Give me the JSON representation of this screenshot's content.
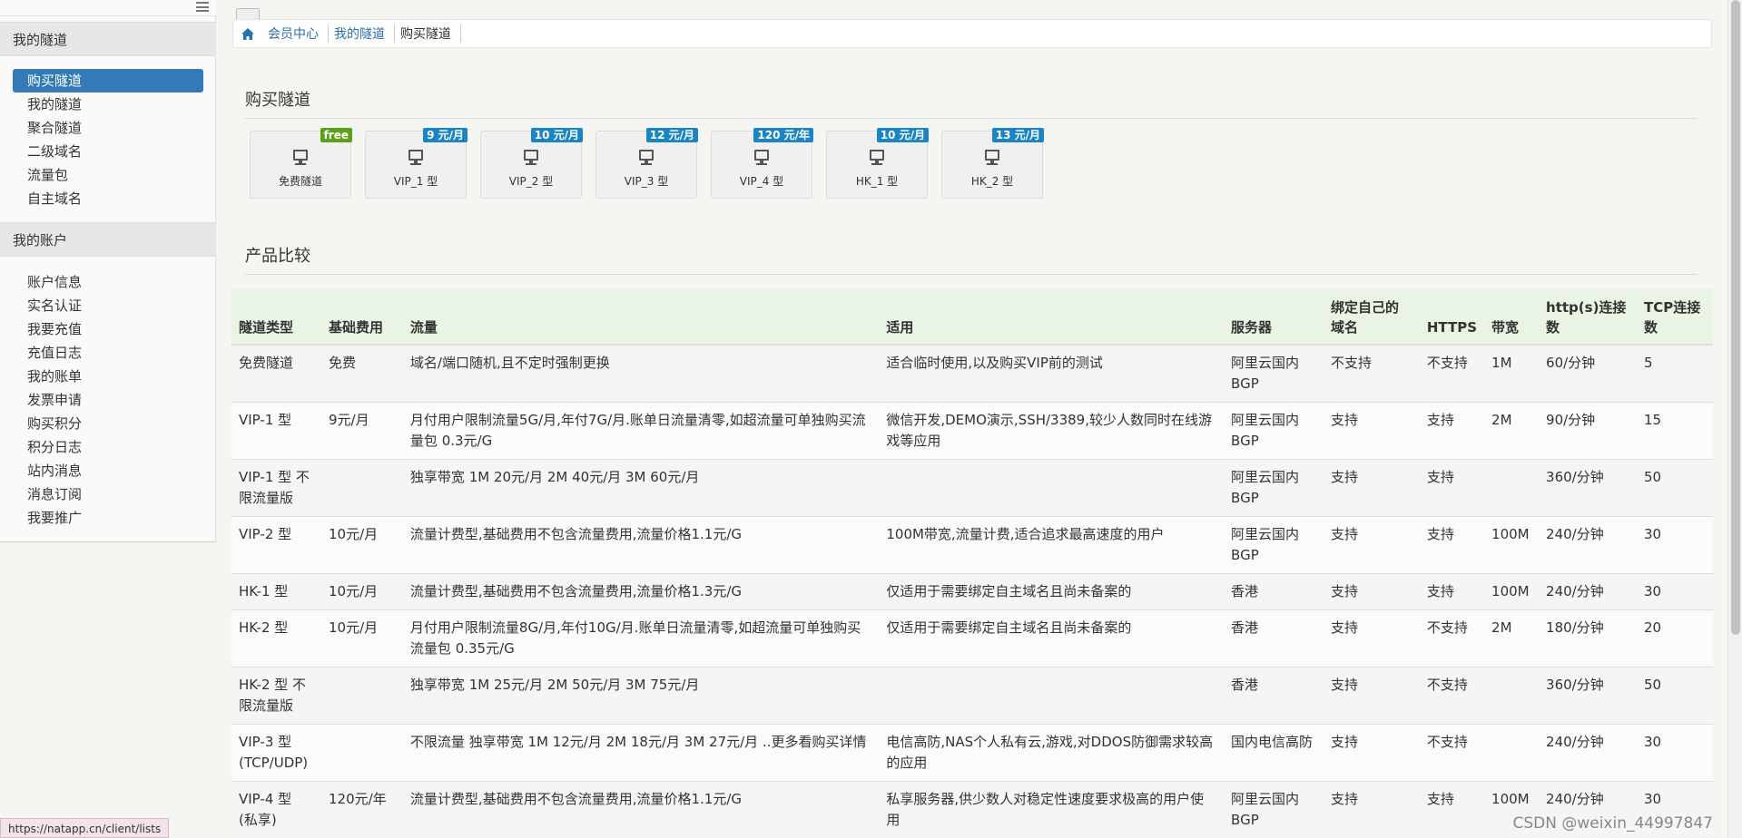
{
  "sidebar": {
    "sections": [
      {
        "title": "我的隧道",
        "items": [
          {
            "label": "购买隧道",
            "active": true
          },
          {
            "label": "我的隧道",
            "active": false
          },
          {
            "label": "聚合隧道",
            "active": false
          },
          {
            "label": "二级域名",
            "active": false
          },
          {
            "label": "流量包",
            "active": false
          },
          {
            "label": "自主域名",
            "active": false
          }
        ]
      },
      {
        "title": "我的账户",
        "items": [
          {
            "label": "账户信息"
          },
          {
            "label": "实名认证"
          },
          {
            "label": "我要充值"
          },
          {
            "label": "充值日志"
          },
          {
            "label": "我的账单"
          },
          {
            "label": "发票申请"
          },
          {
            "label": "购买积分"
          },
          {
            "label": "积分日志"
          },
          {
            "label": "站内消息"
          },
          {
            "label": "消息订阅"
          },
          {
            "label": "我要推广"
          }
        ]
      }
    ]
  },
  "breadcrumb": {
    "items": [
      "会员中心",
      "我的隧道",
      "购买隧道"
    ]
  },
  "buy_section_title": "购买隧道",
  "tunnel_cards": [
    {
      "label": "免费隧道",
      "badge": "free"
    },
    {
      "label": "VIP_1 型",
      "badge": "9 元/月"
    },
    {
      "label": "VIP_2 型",
      "badge": "10 元/月"
    },
    {
      "label": "VIP_3 型",
      "badge": "12 元/月"
    },
    {
      "label": "VIP_4 型",
      "badge": "120 元/年"
    },
    {
      "label": "HK_1 型",
      "badge": "10 元/月"
    },
    {
      "label": "HK_2 型",
      "badge": "13 元/月"
    }
  ],
  "compare_section_title": "产品比较",
  "table": {
    "headers": [
      "隧道类型",
      "基础费用",
      "流量",
      "适用",
      "服务器",
      "绑定自己的域名",
      "HTTPS",
      "带宽",
      "http(s)连接数",
      "TCP连接数"
    ],
    "rows": [
      [
        "免费隧道",
        "免费",
        "域名/端口随机,且不定时强制更换",
        "适合临时使用,以及购买VIP前的测试",
        "阿里云国内BGP",
        "不支持",
        "不支持",
        "1M",
        "60/分钟",
        "5"
      ],
      [
        "VIP-1 型",
        "9元/月",
        "月付用户限制流量5G/月,年付7G/月.账单日流量清零,如超流量可单独购买流量包 0.3元/G",
        "微信开发,DEMO演示,SSH/3389,较少人数同时在线游戏等应用",
        "阿里云国内BGP",
        "支持",
        "支持",
        "2M",
        "90/分钟",
        "15"
      ],
      [
        "VIP-1 型 不限流量版",
        "",
        "独享带宽 1M 20元/月 2M 40元/月 3M 60元/月",
        "",
        "阿里云国内BGP",
        "支持",
        "支持",
        "",
        "360/分钟",
        "50"
      ],
      [
        "VIP-2 型",
        "10元/月",
        "流量计费型,基础费用不包含流量费用,流量价格1.1元/G",
        "100M带宽,流量计费,适合追求最高速度的用户",
        "阿里云国内BGP",
        "支持",
        "支持",
        "100M",
        "240/分钟",
        "30"
      ],
      [
        "HK-1 型",
        "10元/月",
        "流量计费型,基础费用不包含流量费用,流量价格1.3元/G",
        "仅适用于需要绑定自主域名且尚未备案的",
        "香港",
        "支持",
        "支持",
        "100M",
        "240/分钟",
        "30"
      ],
      [
        "HK-2 型",
        "10元/月",
        "月付用户限制流量8G/月,年付10G/月.账单日流量清零,如超流量可单独购买流量包 0.35元/G",
        "仅适用于需要绑定自主域名且尚未备案的",
        "香港",
        "支持",
        "不支持",
        "2M",
        "180/分钟",
        "20"
      ],
      [
        "HK-2 型 不限流量版",
        "",
        "独享带宽 1M 25元/月 2M 50元/月 3M 75元/月",
        "",
        "香港",
        "支持",
        "不支持",
        "",
        "360/分钟",
        "50"
      ],
      [
        "VIP-3 型 (TCP/UDP)",
        "",
        "不限流量 独享带宽 1M 12元/月 2M 18元/月 3M 27元/月 ..更多看购买详情",
        "电信高防,NAS个人私有云,游戏,对DDOS防御需求较高的应用",
        "国内电信高防",
        "支持",
        "不支持",
        "",
        "240/分钟",
        "30"
      ],
      [
        "VIP-4 型 (私享)",
        "120元/年",
        "流量计费型,基础费用不包含流量费用,流量价格1.1元/G",
        "私享服务器,供少数人对稳定性速度要求极高的用户使用",
        "阿里云国内BGP",
        "支持",
        "支持",
        "100M",
        "240/分钟",
        "30"
      ]
    ]
  },
  "status_url": "https://natapp.cn/client/lists",
  "watermark": "CSDN @weixin_44997847",
  "colors": {
    "accent": "#337ab7",
    "badge_blue": "#1a85c4",
    "badge_green": "#5aa117",
    "header_bg": "#e9f4e4"
  }
}
